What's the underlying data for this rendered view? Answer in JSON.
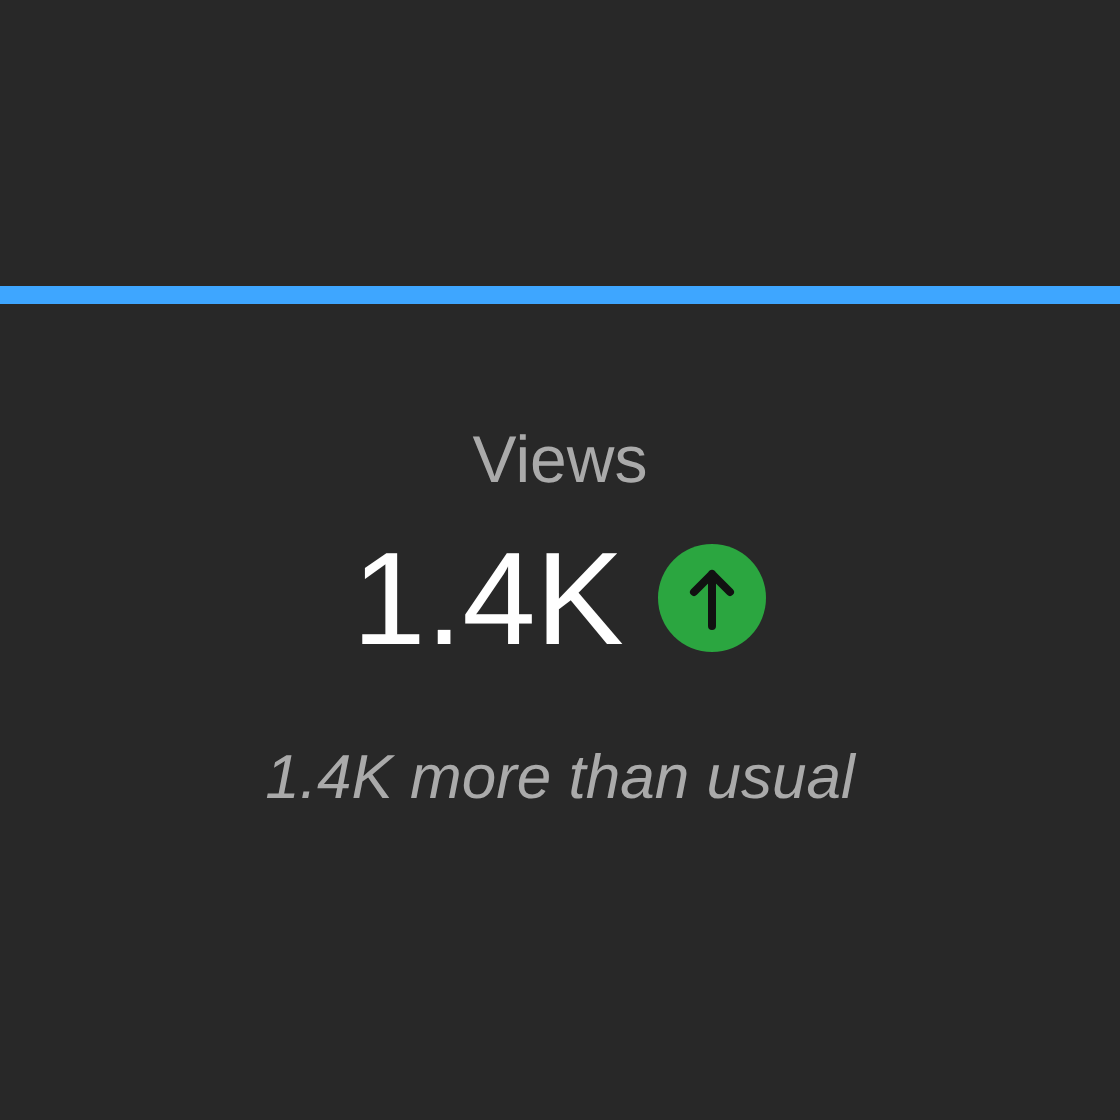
{
  "metric": {
    "label": "Views",
    "value": "1.4K",
    "rising": true,
    "note": "1.4K more than usual"
  }
}
